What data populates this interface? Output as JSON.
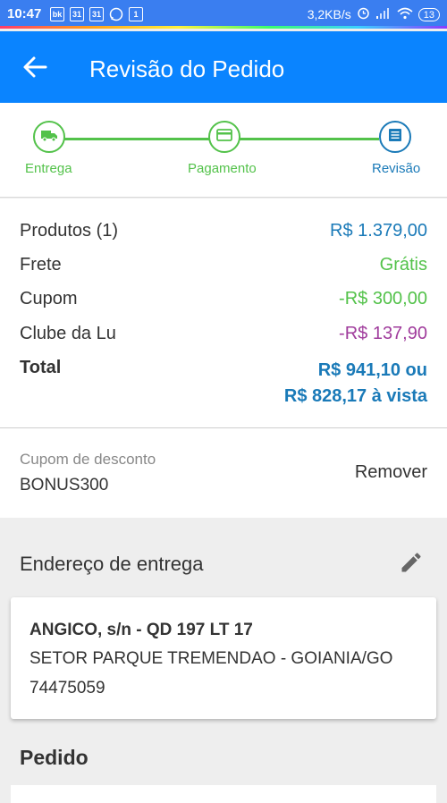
{
  "status_bar": {
    "time": "10:47",
    "icons": [
      "bk-icon",
      "calendar-icon",
      "calendar-icon",
      "whatsapp-icon",
      "notification-icon"
    ],
    "calendar_day_1": "31",
    "calendar_day_2": "31",
    "notification_count": "1",
    "network_speed": "3,2KB/s",
    "battery": "13"
  },
  "app_bar": {
    "title": "Revisão do Pedido",
    "background": "#0a84ff"
  },
  "steps": [
    {
      "label": "Entrega",
      "icon": "truck-icon"
    },
    {
      "label": "Pagamento",
      "icon": "credit-card-icon"
    },
    {
      "label": "Revisão",
      "icon": "list-icon"
    }
  ],
  "summary": {
    "produtos_label": "Produtos (1)",
    "produtos_value": "R$ 1.379,00",
    "frete_label": "Frete",
    "frete_value": "Grátis",
    "cupom_label": "Cupom",
    "cupom_value": "-R$ 300,00",
    "clube_label": "Clube da Lu",
    "clube_value": "-R$ 137,90",
    "total_label": "Total",
    "total_value_1": "R$ 941,10 ou",
    "total_value_2": "R$ 828,17 à vista"
  },
  "coupon": {
    "label": "Cupom de desconto",
    "code": "BONUS300",
    "remove_label": "Remover"
  },
  "address": {
    "title": "Endereço de entrega",
    "line1": "ANGICO, s/n - QD 197 LT 17",
    "line2": "SETOR PARQUE TREMENDAO - GOIANIA/GO",
    "line3": "74475059"
  },
  "order": {
    "title": "Pedido"
  },
  "colors": {
    "green": "#53c24a",
    "blue": "#1a7ab8",
    "purple": "#a03c9c"
  }
}
